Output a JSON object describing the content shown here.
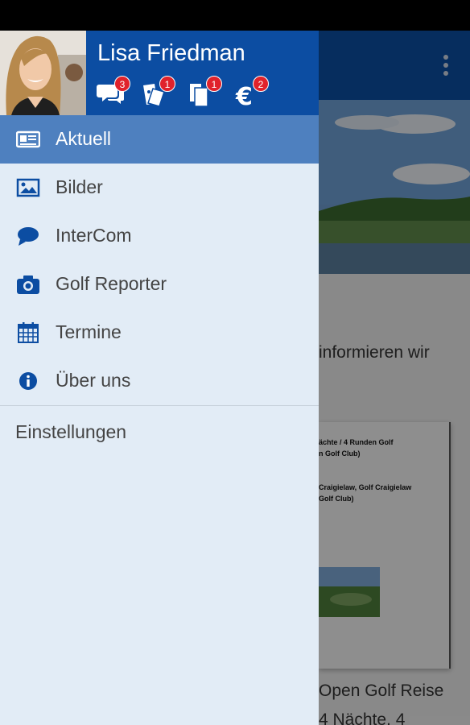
{
  "user": {
    "name": "Lisa Friedman"
  },
  "header_icons": [
    {
      "icon": "chat-bubbles-icon",
      "badge": "3"
    },
    {
      "icon": "tickets-icon",
      "badge": "1"
    },
    {
      "icon": "documents-icon",
      "badge": "1"
    },
    {
      "icon": "euro-icon",
      "badge": "2"
    }
  ],
  "menu": {
    "items": [
      {
        "label": "Aktuell",
        "icon": "newspaper-icon"
      },
      {
        "label": "Bilder",
        "icon": "picture-icon"
      },
      {
        "label": "InterCom",
        "icon": "chat-bubble-icon"
      },
      {
        "label": "Golf Reporter",
        "icon": "camera-icon"
      },
      {
        "label": "Termine",
        "icon": "calendar-icon"
      },
      {
        "label": "Über uns",
        "icon": "info-icon"
      }
    ],
    "settings": "Einstellungen"
  },
  "background": {
    "article_text_1": "informieren wir",
    "doc_lines": [
      "ächte / 4 Runden Golf",
      "n Golf Club)",
      "Craigielaw, Golf Craigielaw",
      "Golf Club)"
    ],
    "article_title_1": "Open Golf Reise",
    "article_title_2": "4 Nächte, 4"
  },
  "colors": {
    "drawer_header": "#0c4da2",
    "active_item": "#4e80bf",
    "drawer_background": "#e2ecf6",
    "badge": "#e0222b",
    "icon_blue": "#0c4da2"
  }
}
